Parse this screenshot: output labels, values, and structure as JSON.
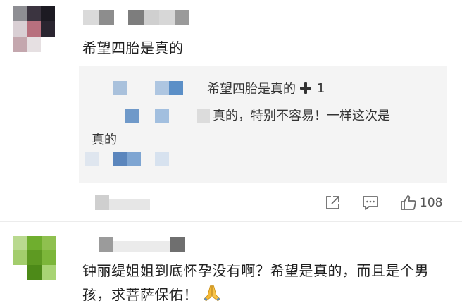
{
  "comment1": {
    "text": "希望四胎是真的"
  },
  "quoted_reply": {
    "line1_text": "希望四胎是真的",
    "line1_suffix": "1",
    "line2_text": "真的，特别不容易！一样这次是",
    "line3_text": "真的"
  },
  "actions": {
    "like_count": "108",
    "share_icon": "share-icon",
    "comment_icon": "comment-icon",
    "like_icon": "thumbs-up-icon"
  },
  "comment2": {
    "text": "钟丽缇姐姐到底怀孕没有啊？希望是真的，而且是个男孩，求菩萨保佑！",
    "emoji_icon": "praying-hands-icon"
  },
  "colors": {
    "text_primary": "#1f1f1f",
    "reply_bg": "#f4f4f4",
    "icon_gray": "#6b6b6b",
    "mosaic_blue": "#5b8fc7",
    "avatar2_green": "#6fae2e"
  }
}
